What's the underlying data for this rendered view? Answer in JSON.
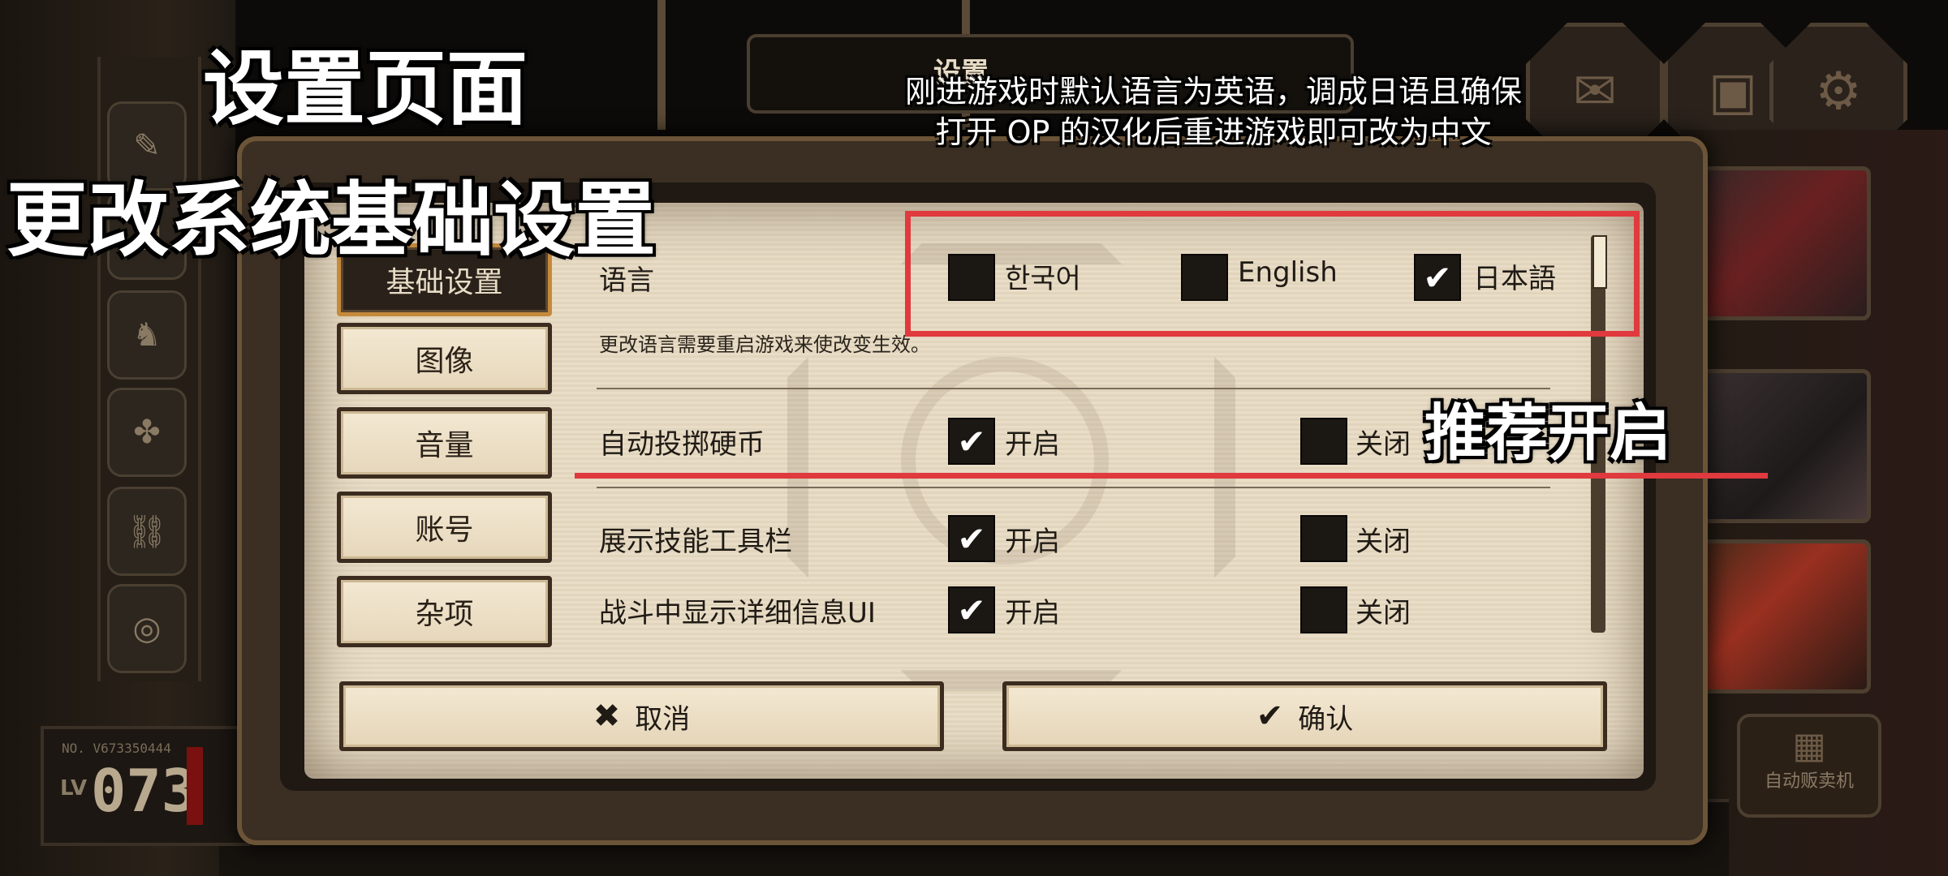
{
  "overlay": {
    "title_line1": "设置页面",
    "title_line2": "更改系统基础设置",
    "note": "刚进游戏时默认语言为英语，调成日语且确保打开 OP 的汉化后重进游戏即可改为中文",
    "recommend": "推荐开启",
    "highlight_color": "#e0393e"
  },
  "background": {
    "top_title": "设置",
    "player_no": "NO. V673350444",
    "player_lv_label": "LV",
    "player_level": "073",
    "vending_label": "自动贩卖机"
  },
  "tabs": [
    {
      "label": "基础设置",
      "active": true
    },
    {
      "label": "图像",
      "active": false
    },
    {
      "label": "音量",
      "active": false
    },
    {
      "label": "账号",
      "active": false
    },
    {
      "label": "杂项",
      "active": false
    }
  ],
  "language": {
    "label": "语言",
    "hint": "更改语言需要重启游戏来使改变生效。",
    "options": [
      {
        "label": "한국어",
        "checked": false
      },
      {
        "label": "English",
        "checked": false
      },
      {
        "label": "日本語",
        "checked": true
      }
    ]
  },
  "settings": [
    {
      "label": "自动投掷硬币",
      "on_label": "开启",
      "off_label": "关闭",
      "value": "on"
    },
    {
      "label": "展示技能工具栏",
      "on_label": "开启",
      "off_label": "关闭",
      "value": "on"
    },
    {
      "label": "战斗中显示详细信息UI",
      "on_label": "开启",
      "off_label": "关闭",
      "value": "on"
    }
  ],
  "buttons": {
    "cancel": "取消",
    "confirm": "确认"
  }
}
